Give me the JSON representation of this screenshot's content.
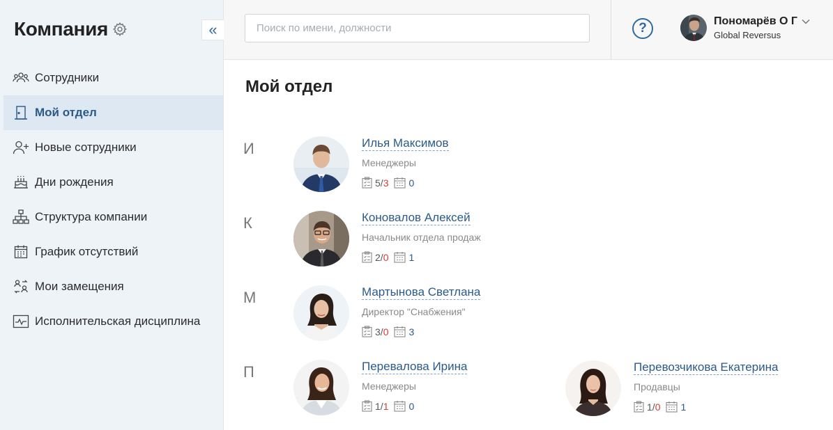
{
  "sidebar": {
    "title": "Компания",
    "collapse_glyph": "«",
    "items": [
      {
        "label": "Сотрудники",
        "icon": "users-icon"
      },
      {
        "label": "Мой отдел",
        "icon": "door-icon",
        "active": true
      },
      {
        "label": "Новые сотрудники",
        "icon": "user-plus-icon"
      },
      {
        "label": "Дни рождения",
        "icon": "cake-icon"
      },
      {
        "label": "Структура компании",
        "icon": "org-structure-icon"
      },
      {
        "label": "График отсутствий",
        "icon": "calendar-icon"
      },
      {
        "label": "Мои замещения",
        "icon": "replacement-icon"
      },
      {
        "label": "Исполнительская дисциплина",
        "icon": "chart-pulse-icon"
      }
    ]
  },
  "search": {
    "placeholder": "Поиск по имени, должности",
    "value": ""
  },
  "header": {
    "help_glyph": "?",
    "user": {
      "name": "Пономарёв О Г",
      "company": "Global Reversus"
    }
  },
  "main": {
    "title": "Мой отдел",
    "groups": [
      {
        "letter": "И",
        "employees": [
          {
            "name": "Илья Максимов",
            "position": "Менеджеры",
            "tasks_total": "5",
            "tasks_overdue": "3",
            "events": "0"
          }
        ]
      },
      {
        "letter": "К",
        "employees": [
          {
            "name": "Коновалов Алексей",
            "position": "Начальник отдела продаж",
            "tasks_total": "2",
            "tasks_overdue": "0",
            "events": "1"
          }
        ]
      },
      {
        "letter": "М",
        "employees": [
          {
            "name": "Мартынова Светлана",
            "position": "Директор \"Снабжения\"",
            "tasks_total": "3",
            "tasks_overdue": "0",
            "events": "3"
          }
        ]
      },
      {
        "letter": "П",
        "employees": [
          {
            "name": "Перевалова Ирина",
            "position": "Менеджеры",
            "tasks_total": "1",
            "tasks_overdue": "1",
            "events": "0"
          },
          {
            "name": "Перевозчикова Екатерина",
            "position": "Продавцы",
            "tasks_total": "1",
            "tasks_overdue": "0",
            "events": "1"
          }
        ]
      }
    ]
  },
  "colors": {
    "accent": "#2b5a88",
    "overdue": "#d13c3c",
    "sidebar_bg": "#eef3f8"
  }
}
